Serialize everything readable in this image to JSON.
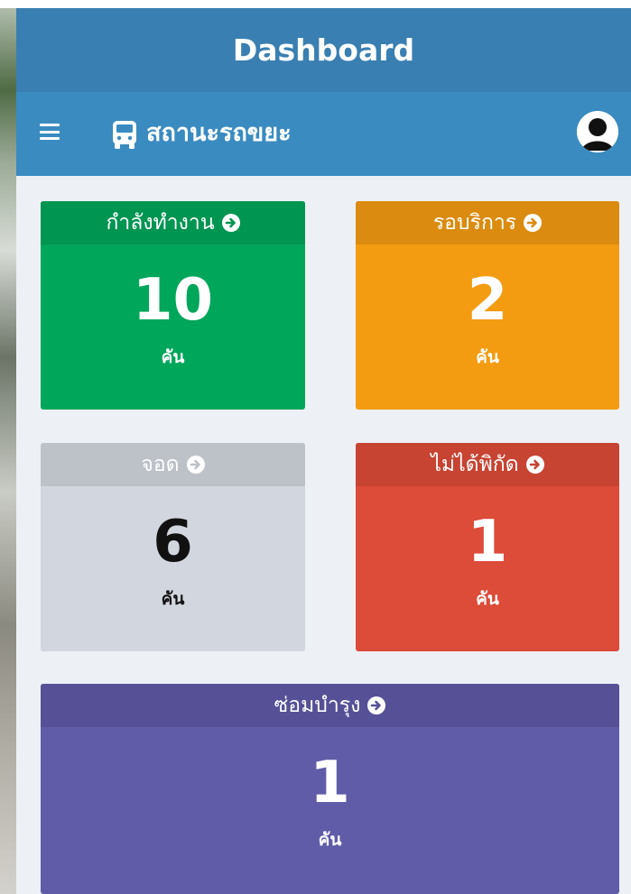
{
  "header": {
    "title": "Dashboard"
  },
  "nav": {
    "title": "สถานะรถขยะ",
    "menu_icon": "menu-icon",
    "bus_icon": "bus-icon",
    "avatar_icon": "user-avatar-icon"
  },
  "cards": [
    {
      "label": "กำลังทำงาน",
      "value": "10",
      "unit": "คัน",
      "color": "#00a65a"
    },
    {
      "label": "รอบริการ",
      "value": "2",
      "unit": "คัน",
      "color": "#f39c12"
    },
    {
      "label": "จอด",
      "value": "6",
      "unit": "คัน",
      "color": "#d2d6de"
    },
    {
      "label": "ไม่ได้พิกัด",
      "value": "1",
      "unit": "คัน",
      "color": "#dd4b39"
    },
    {
      "label": "ซ่อมบำรุง",
      "value": "1",
      "unit": "คัน",
      "color": "#605ca8"
    }
  ]
}
